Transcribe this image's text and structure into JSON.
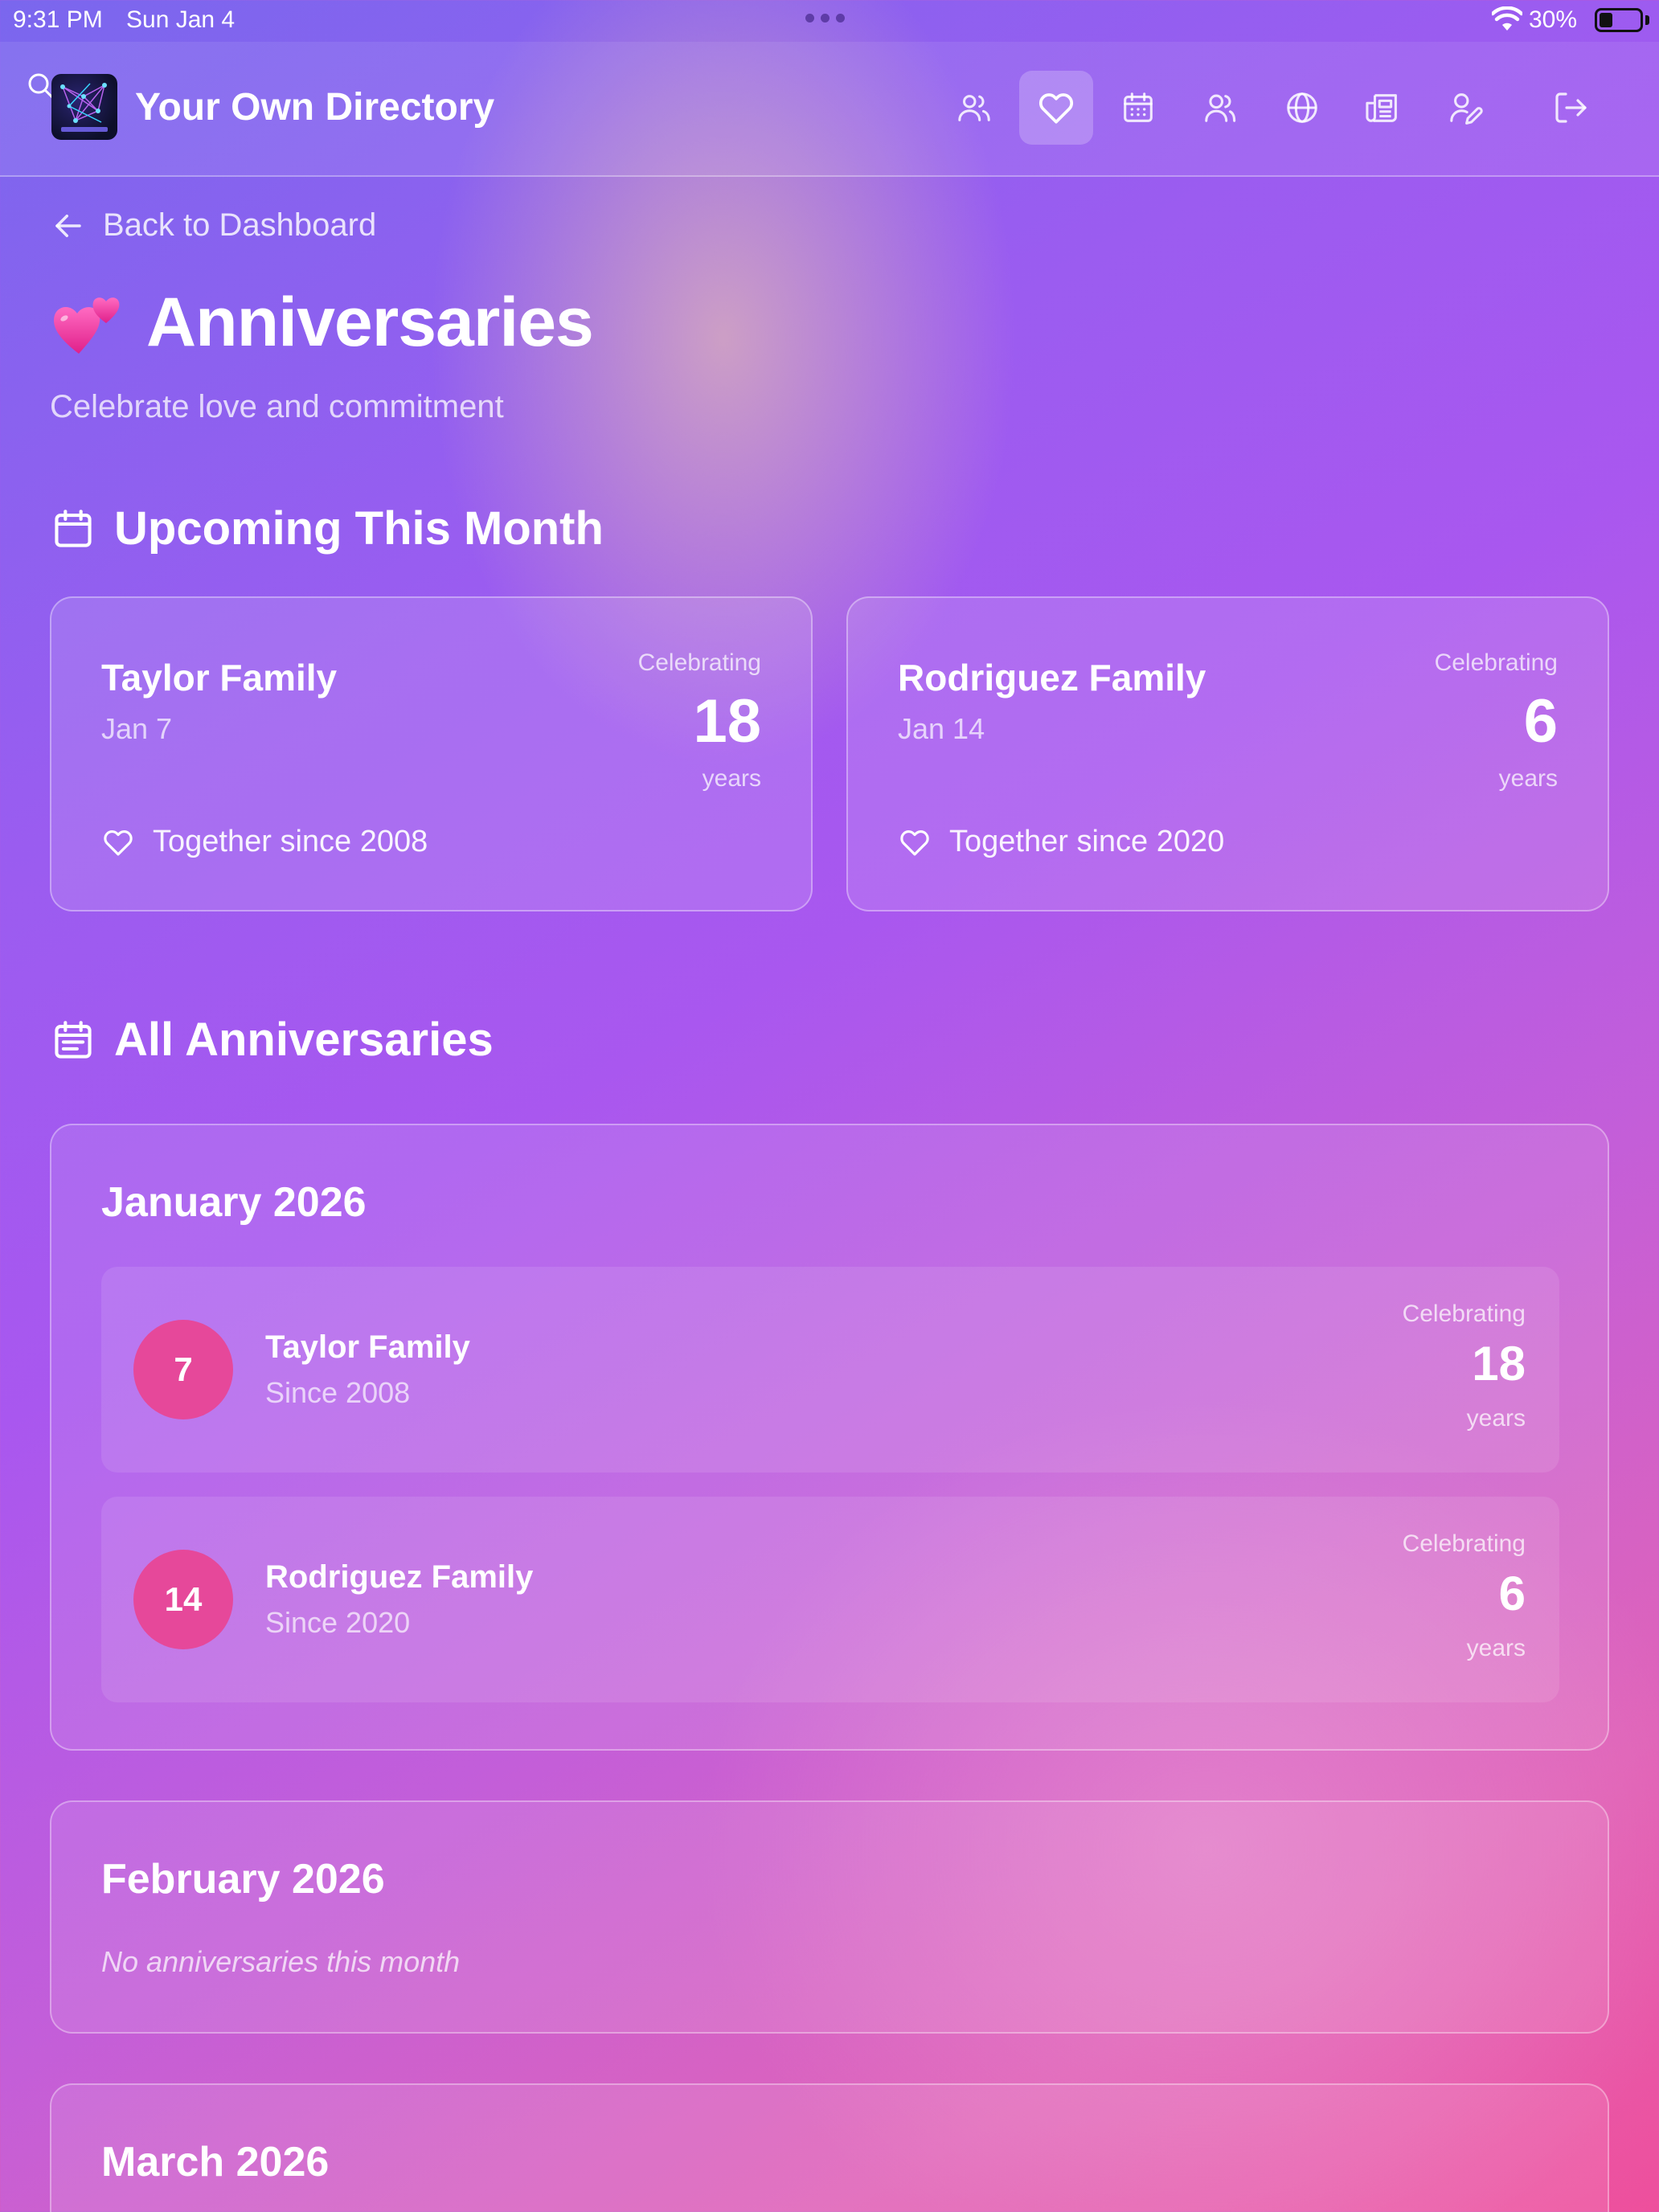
{
  "status_bar": {
    "time": "9:31 PM",
    "date": "Sun Jan 4",
    "battery": "30%"
  },
  "header": {
    "app_name": "Your Own Directory",
    "nav_icons": [
      "people-icon",
      "heart-icon",
      "calendar-icon",
      "users-icon",
      "globe-icon",
      "newspaper-icon",
      "user-edit-icon"
    ],
    "active_nav": "heart-icon",
    "logout_icon": "logout-icon"
  },
  "back_link": {
    "label": "Back to Dashboard"
  },
  "page": {
    "title_emoji": "two-hearts-emoji",
    "title": "Anniversaries",
    "subtitle": "Celebrate love and commitment"
  },
  "upcoming": {
    "heading": "Upcoming This Month",
    "cards": [
      {
        "family": "Taylor Family",
        "date": "Jan 7",
        "celebrating": "Celebrating",
        "years": "18",
        "years_label": "years",
        "since": "Together since 2008"
      },
      {
        "family": "Rodriguez Family",
        "date": "Jan 14",
        "celebrating": "Celebrating",
        "years": "6",
        "years_label": "years",
        "since": "Together since 2020"
      }
    ]
  },
  "all": {
    "heading": "All Anniversaries",
    "months": [
      {
        "title": "January 2026",
        "entries": [
          {
            "day": "7",
            "family": "Taylor Family",
            "since": "Since 2008",
            "celebrating": "Celebrating",
            "years": "18",
            "years_label": "years"
          },
          {
            "day": "14",
            "family": "Rodriguez Family",
            "since": "Since 2020",
            "celebrating": "Celebrating",
            "years": "6",
            "years_label": "years"
          }
        ]
      },
      {
        "title": "February 2026",
        "empty": "No anniversaries this month"
      },
      {
        "title": "March 2026"
      }
    ]
  },
  "colors": {
    "accent_pink": "#e6489a",
    "gradient_start": "#7a67ee",
    "gradient_end": "#ee4f9c"
  }
}
